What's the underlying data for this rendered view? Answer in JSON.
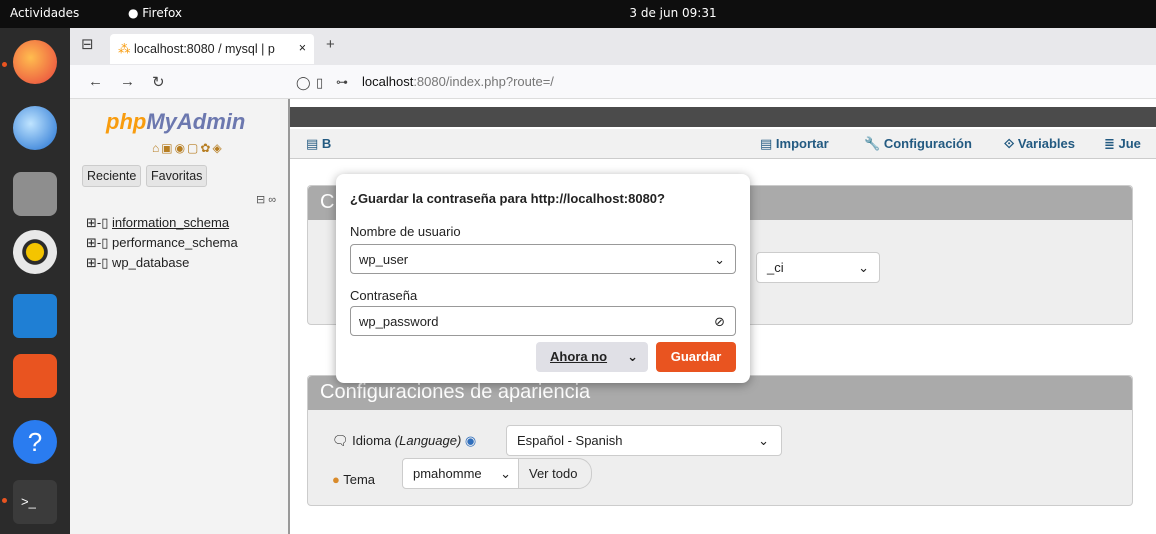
{
  "topbar": {
    "activities": "Actividades",
    "app": "Firefox",
    "clock": "3 de jun  09:31"
  },
  "browser": {
    "tab_title": "localhost:8080 / mysql | p",
    "url_host": "localhost",
    "url_rest": ":8080/index.php?route=/"
  },
  "pma": {
    "logo_php": "php",
    "logo_my": "MyAdmin",
    "recent": "Reciente",
    "favorites": "Favoritas",
    "databases": [
      "information_schema",
      "performance_schema",
      "wp_database"
    ],
    "menu": {
      "b": "B",
      "import": "Importar",
      "settings": "Configuración",
      "variables": "Variables",
      "charsets": "Jue"
    },
    "panel1_title_partial": "C",
    "collation_partial": "_ci",
    "appearance_title": "Configuraciones de apariencia",
    "language_label": "Idioma",
    "language_sub": "(Language)",
    "language_value": "Español - Spanish",
    "theme_label": "Tema",
    "theme_value": "pmahomme",
    "view_all": "Ver todo"
  },
  "popup": {
    "title": "¿Guardar la contraseña para http://localhost:8080?",
    "user_label": "Nombre de usuario",
    "user_value": "wp_user",
    "pass_label": "Contraseña",
    "pass_value": "wp_password",
    "not_now": "Ahora no",
    "save": "Guardar"
  }
}
